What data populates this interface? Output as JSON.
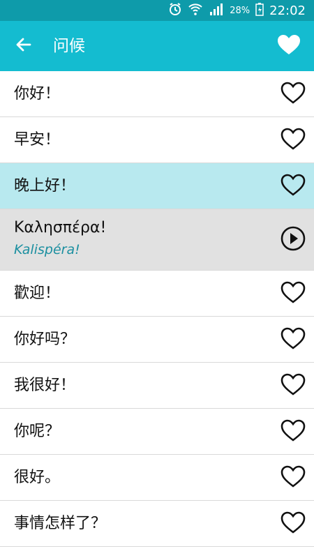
{
  "status_bar": {
    "battery": "28%",
    "time": "22:02",
    "icons": [
      "alarm-icon",
      "wifi-icon",
      "signal-icon",
      "battery-charging-icon"
    ]
  },
  "header": {
    "title": "问候",
    "back_icon": "arrow-left-icon",
    "favorite_icon": "heart-filled-icon"
  },
  "colors": {
    "status_bar": "#0E9BAA",
    "app_bar": "#14BCD0",
    "highlight_row": "#B8E9EF",
    "expanded_row": "#E1E1E1",
    "transliteration": "#1B8FA0"
  },
  "phrases": [
    {
      "text": "你好！"
    },
    {
      "text": "早安！"
    },
    {
      "text": "晚上好！"
    },
    {
      "text": "Καλησπέρα!",
      "transliteration": "Kalispéra!"
    },
    {
      "text": "歡迎！"
    },
    {
      "text": "你好吗？"
    },
    {
      "text": "我很好！"
    },
    {
      "text": "你呢？"
    },
    {
      "text": "很好。"
    },
    {
      "text": "事情怎样了？"
    }
  ]
}
